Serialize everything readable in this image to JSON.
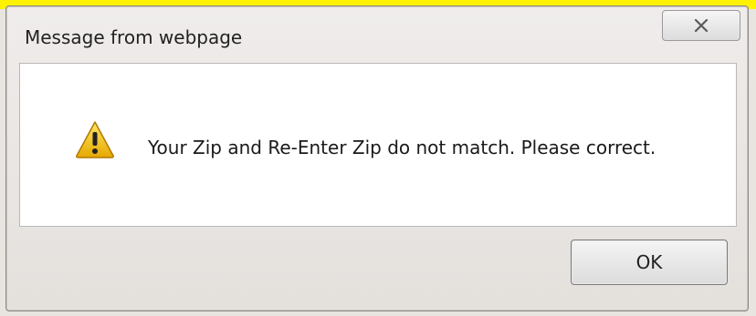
{
  "dialog": {
    "title": "Message from webpage",
    "close_icon": "close-icon",
    "message": "Your Zip and Re-Enter Zip do not match. Please correct.",
    "message_icon": "warning-icon",
    "ok_label": "OK"
  },
  "colors": {
    "highlight_strip": "#fff200",
    "warning_yellow": "#f2c200",
    "content_bg": "#ffffff"
  }
}
